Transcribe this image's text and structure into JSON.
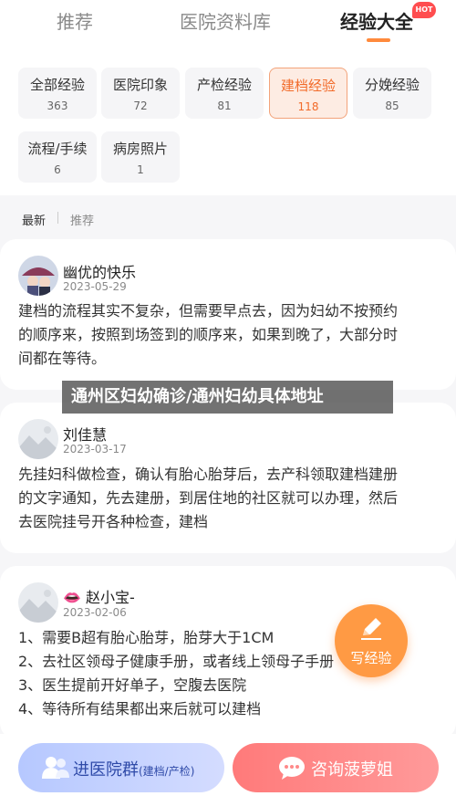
{
  "tabs": [
    {
      "label": "推荐"
    },
    {
      "label": "医院资料库"
    },
    {
      "label": "经验大全",
      "badge": "HOT"
    }
  ],
  "categories": [
    {
      "name": "全部经验",
      "count": "363"
    },
    {
      "name": "医院印象",
      "count": "72"
    },
    {
      "name": "产检经验",
      "count": "81"
    },
    {
      "name": "建档经验",
      "count": "118"
    },
    {
      "name": "分娩经验",
      "count": "85"
    },
    {
      "name": "流程/手续",
      "count": "6"
    },
    {
      "name": "病房照片",
      "count": "1"
    }
  ],
  "sort": {
    "latest": "最新",
    "recommended": "推荐"
  },
  "posts": [
    {
      "author": "幽优的快乐",
      "date": "2023-05-29",
      "text": "建档的流程其实不复杂，但需要早点去，因为妇幼不按预约\n的顺序来，按照到场签到的顺序来，如果到晚了，大部分时\n间都在等待。"
    },
    {
      "author": "刘佳慧",
      "date": "2023-03-17",
      "text": "先挂妇科做检查，确认有胎心胎芽后，去产科领取建档建册\n的文字通知，先去建册，到居住地的社区就可以办理，然后\n去医院挂号开各种检查，建档"
    },
    {
      "author": "赵小宝-",
      "date": "2023-02-06",
      "text": "1、需要B超有胎心胎芽，胎芽大于1CM\n2、去社区领母子健康手册，或者线上领母子手册\n3、医生提前开好单子，空腹去医院\n4、等待所有结果都出来后就可以建档"
    }
  ],
  "banner": "通州区妇幼确诊/通州妇幼具体地址",
  "fab": {
    "label": "写经验",
    "icon": "pencil-icon"
  },
  "bottom": {
    "group_label": "进医院群",
    "group_sub": "(建档/产检)",
    "consult_label": "咨询菠萝姐"
  },
  "colors": {
    "accent": "#ff8a3c",
    "active_category_bg": "#fdece3",
    "active_category_text": "#f26b2a",
    "group_button": "#c6d2ff",
    "consult_button": "#ff8a8a"
  }
}
